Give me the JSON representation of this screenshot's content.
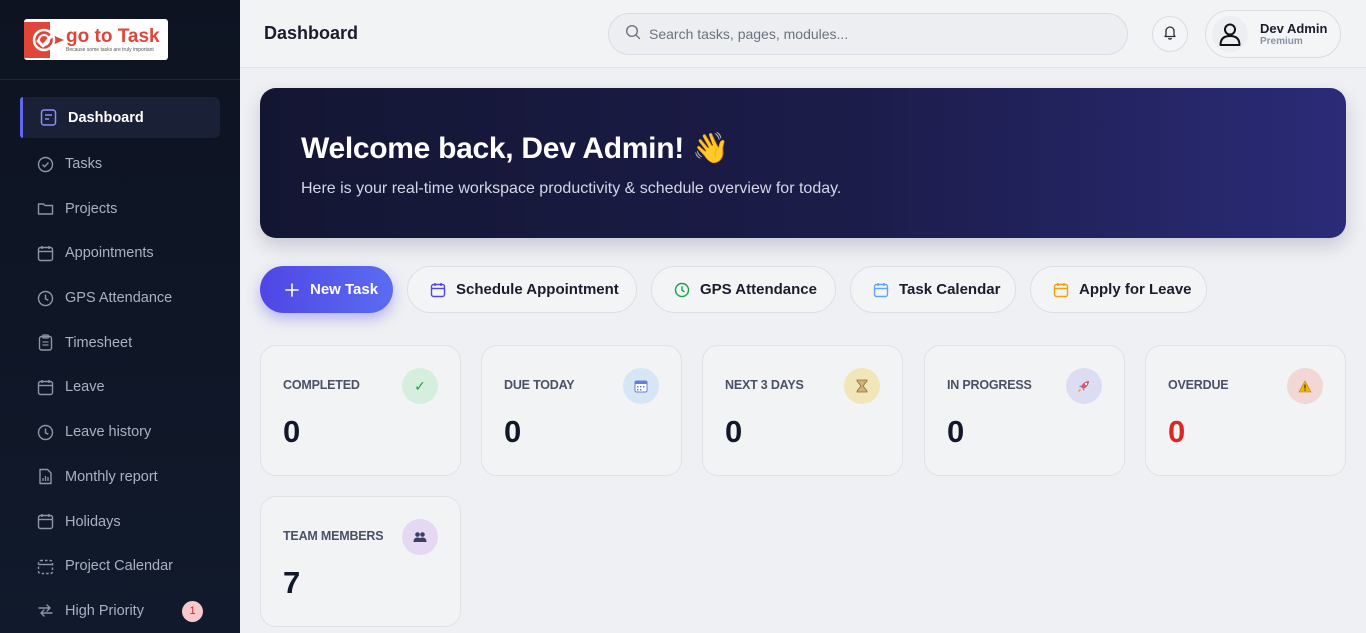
{
  "brand": {
    "name": "go to Task",
    "tagline": "Because some tasks are truly important"
  },
  "sidebar": {
    "items": [
      {
        "label": "Dashboard",
        "icon": "dashboard-icon",
        "active": true
      },
      {
        "label": "Tasks",
        "icon": "check-circle-icon"
      },
      {
        "label": "Projects",
        "icon": "folder-icon"
      },
      {
        "label": "Appointments",
        "icon": "calendar-icon"
      },
      {
        "label": "GPS Attendance",
        "icon": "clock-icon"
      },
      {
        "label": "Timesheet",
        "icon": "clipboard-icon"
      },
      {
        "label": "Leave",
        "icon": "calendar-icon"
      },
      {
        "label": "Leave history",
        "icon": "clock-icon"
      },
      {
        "label": "Monthly report",
        "icon": "report-icon"
      },
      {
        "label": "Holidays",
        "icon": "calendar-icon"
      },
      {
        "label": "Project Calendar",
        "icon": "calendar-dashed-icon"
      },
      {
        "label": "High Priority",
        "icon": "arrows-icon",
        "badge": "1"
      }
    ]
  },
  "header": {
    "title": "Dashboard",
    "search_placeholder": "Search tasks, pages, modules...",
    "user": {
      "name": "Dev Admin",
      "plan": "Premium"
    }
  },
  "hero": {
    "title": "Welcome back, Dev Admin! 👋",
    "subtitle": "Here is your real-time workspace productivity & schedule overview for today."
  },
  "actions": [
    {
      "label": "New Task",
      "icon": "plus-icon",
      "primary": true
    },
    {
      "label": "Schedule Appointment",
      "icon": "calendar-icon"
    },
    {
      "label": "GPS Attendance",
      "icon": "clock-icon"
    },
    {
      "label": "Task Calendar",
      "icon": "calendar-icon"
    },
    {
      "label": "Apply for Leave",
      "icon": "calendar-icon"
    }
  ],
  "stats": [
    {
      "label": "COMPLETED",
      "value": "0",
      "icon": "check-icon",
      "color": "#16a34a"
    },
    {
      "label": "DUE TODAY",
      "value": "0",
      "icon": "calendar-icon",
      "color": "#2563eb"
    },
    {
      "label": "NEXT 3 DAYS",
      "value": "0",
      "icon": "hourglass-icon",
      "color": "#ca8a04"
    },
    {
      "label": "IN PROGRESS",
      "value": "0",
      "icon": "rocket-icon",
      "color": "#6366f1"
    },
    {
      "label": "OVERDUE",
      "value": "0",
      "icon": "warning-icon",
      "color": "#dc2626"
    },
    {
      "label": "TEAM MEMBERS",
      "value": "7",
      "icon": "users-icon",
      "color": "#7c3aed"
    }
  ],
  "colors": {
    "accent": "#4f46e5",
    "sidebar_bg": "#0f1626",
    "overdue": "#dc2626"
  }
}
